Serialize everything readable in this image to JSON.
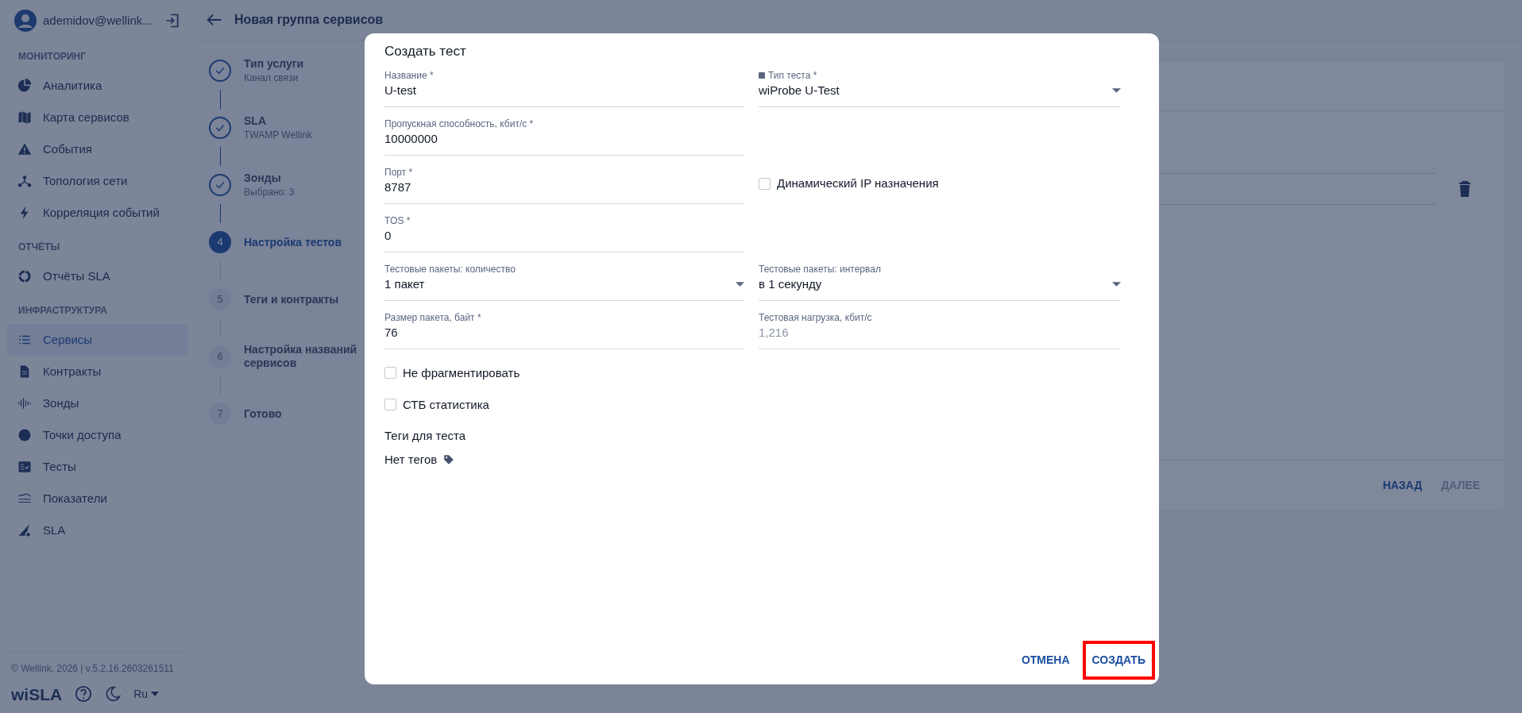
{
  "sidebar": {
    "user": "ademidov@wellink...",
    "sections": [
      {
        "title": "МОНИТОРИНГ",
        "items": [
          {
            "label": "Аналитика",
            "selected": false
          },
          {
            "label": "Карта сервисов",
            "selected": false
          },
          {
            "label": "События",
            "selected": false
          },
          {
            "label": "Топология сети",
            "selected": false
          },
          {
            "label": "Корреляция событий",
            "selected": false
          }
        ]
      },
      {
        "title": "ОТЧЁТЫ",
        "items": [
          {
            "label": "Отчёты SLA",
            "selected": false
          }
        ]
      },
      {
        "title": "ИНФРАСТРУКТУРА",
        "items": [
          {
            "label": "Сервисы",
            "selected": true
          },
          {
            "label": "Контракты",
            "selected": false
          },
          {
            "label": "Зонды",
            "selected": false
          },
          {
            "label": "Точки доступа",
            "selected": false
          },
          {
            "label": "Тесты",
            "selected": false
          },
          {
            "label": "Показатели",
            "selected": false
          },
          {
            "label": "SLA",
            "selected": false
          }
        ]
      }
    ],
    "copyright": "© Wellink, 2026 | v.5.2.16.2603261511",
    "logo": "wiSLA",
    "language": "Ru"
  },
  "header": {
    "title": "Новая группа сервисов"
  },
  "steps": [
    {
      "title": "Тип услуги",
      "subtitle": "Канал связи",
      "completed": true,
      "selected": false
    },
    {
      "title": "SLA",
      "subtitle": "TWAMP Wellink",
      "completed": true,
      "selected": false
    },
    {
      "title": "Зонды",
      "subtitle": "Выбрано: 3",
      "completed": true,
      "selected": false
    },
    {
      "number": "4",
      "title": "Настройка тестов",
      "completed": false,
      "selected": true
    },
    {
      "number": "5",
      "title": "Теги и контракты",
      "completed": false,
      "selected": false
    },
    {
      "number": "6",
      "title": "Настройка названий сервисов",
      "completed": false,
      "selected": false
    },
    {
      "number": "7",
      "title": "Готово",
      "completed": false,
      "selected": false
    }
  ],
  "card": {
    "buttons": [
      {
        "label": "НАЗАД",
        "disabled": false
      },
      {
        "label": "ДАЛЕЕ",
        "disabled": true
      }
    ]
  },
  "dialog": {
    "title": "Создать тест",
    "field_rows": [
      {
        "left": {
          "kind": "text",
          "label": "Название *",
          "value": "U-test"
        },
        "right": {
          "kind": "select",
          "label": "Тип теста *",
          "value": "wiProbe U-Test",
          "has_icon": true
        }
      },
      {
        "left": {
          "kind": "text",
          "label": "Пропускная способность, кбит/с *",
          "value": "10000000"
        }
      },
      {
        "left": {
          "kind": "text",
          "label": "Порт *",
          "value": "8787"
        },
        "right": {
          "kind": "checkbox",
          "label": "Динамический IP назначения",
          "checked": false
        }
      },
      {
        "left": {
          "kind": "text",
          "label": "TOS *",
          "value": "0"
        }
      },
      {
        "left": {
          "kind": "select",
          "label": "Тестовые пакеты: количество",
          "value": "1 пакет"
        },
        "right": {
          "kind": "select",
          "label": "Тестовые пакеты: интервал",
          "value": "в 1 секунду"
        }
      },
      {
        "left": {
          "kind": "text",
          "label": "Размер пакета, байт *",
          "value": "76"
        },
        "right": {
          "kind": "text",
          "label": "Тестовая нагрузка, кбит/с",
          "value": "1,216",
          "disabled": true
        }
      }
    ],
    "checkboxes": [
      {
        "label": "Не фрагментировать",
        "checked": false
      },
      {
        "label": "СТБ статистика",
        "checked": false
      }
    ],
    "tags_title": "Теги для теста",
    "tags_empty": "Нет тегов",
    "buttons": [
      {
        "label": "ОТМЕНА",
        "highlighted": false
      },
      {
        "label": "СОЗДАТЬ",
        "highlighted": true
      }
    ]
  }
}
